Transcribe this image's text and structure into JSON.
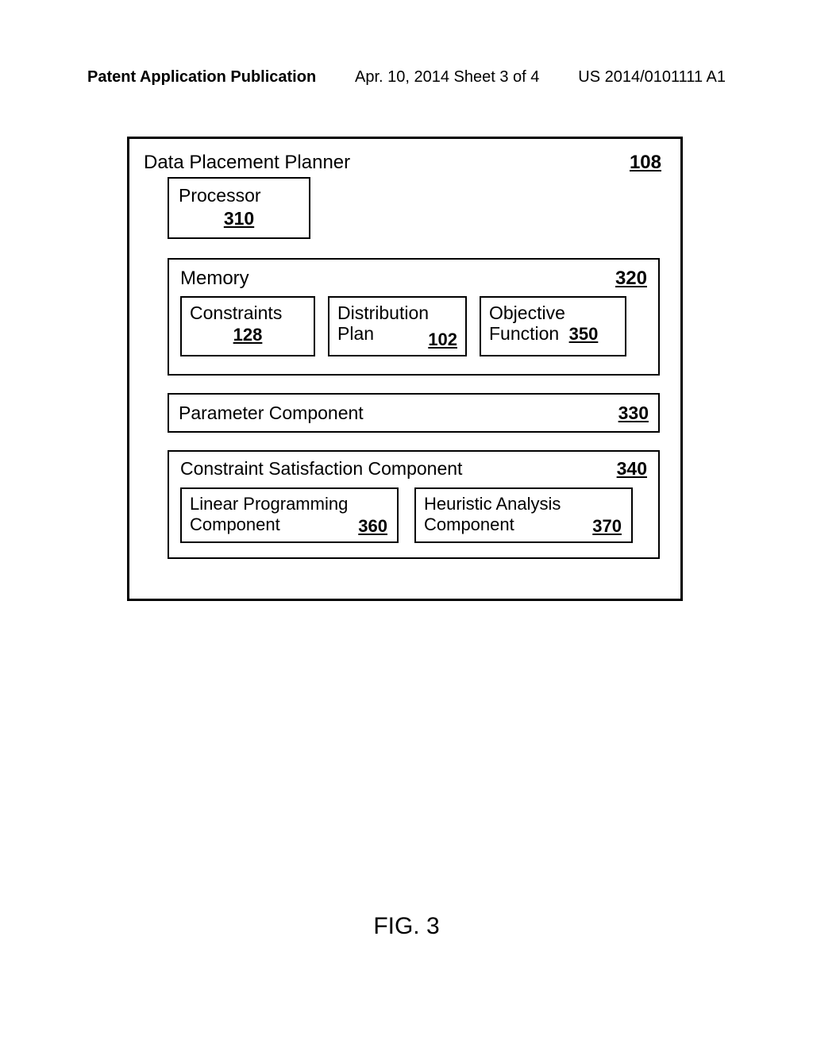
{
  "header": {
    "left": "Patent Application Publication",
    "mid": "Apr. 10, 2014  Sheet 3 of 4",
    "right": "US 2014/0101111 A1"
  },
  "planner": {
    "title": "Data Placement Planner",
    "ref": "108"
  },
  "processor": {
    "label": "Processor",
    "ref": "310"
  },
  "memory": {
    "label": "Memory",
    "ref": "320",
    "constraints": {
      "label": "Constraints",
      "ref": "128"
    },
    "distribution": {
      "l1": "Distribution",
      "l2": "Plan",
      "ref": "102"
    },
    "objective": {
      "l1": "Objective",
      "l2": "Function",
      "ref": "350"
    }
  },
  "param": {
    "label": "Parameter Component",
    "ref": "330"
  },
  "csc": {
    "label": "Constraint Satisfaction Component",
    "ref": "340",
    "lp": {
      "l1": "Linear Programming",
      "l2": "Component",
      "ref": "360"
    },
    "ha": {
      "l1": "Heuristic Analysis",
      "l2": "Component",
      "ref": "370"
    }
  },
  "figure": "FIG. 3"
}
